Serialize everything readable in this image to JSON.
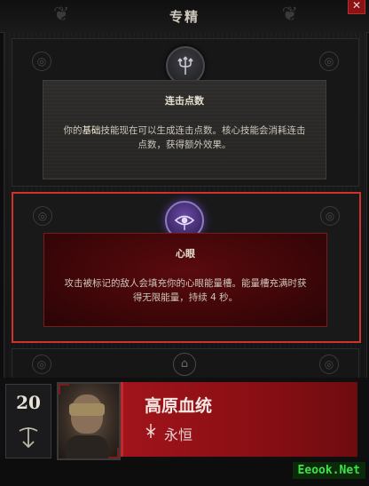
{
  "header": {
    "title": "专精",
    "close_symbol": "✕"
  },
  "cards": [
    {
      "title": "连击点数",
      "description_lead": "你的",
      "description_keyword": "基础",
      "description_rest": "技能现在可以生成连击点数。核心技能会消耗连击点数，获得额外效果。",
      "icon": "trident-icon",
      "selected": false
    },
    {
      "title": "心眼",
      "description": "攻击被标记的敌人会填充你的心眼能量槽。能量槽充满时获得无限能量，持续 4 秒。",
      "icon": "eye-icon",
      "selected": true
    }
  ],
  "character": {
    "level": "20",
    "name": "高原血统",
    "realm": "永恒",
    "class_icon": "crossbow-icon",
    "realm_icon": "flame-icon"
  },
  "watermark": "Eeook.Net",
  "colors": {
    "accent_red": "#d2312e",
    "banner_red": "#9a1218",
    "selected_glow": "#6a4aa8"
  }
}
